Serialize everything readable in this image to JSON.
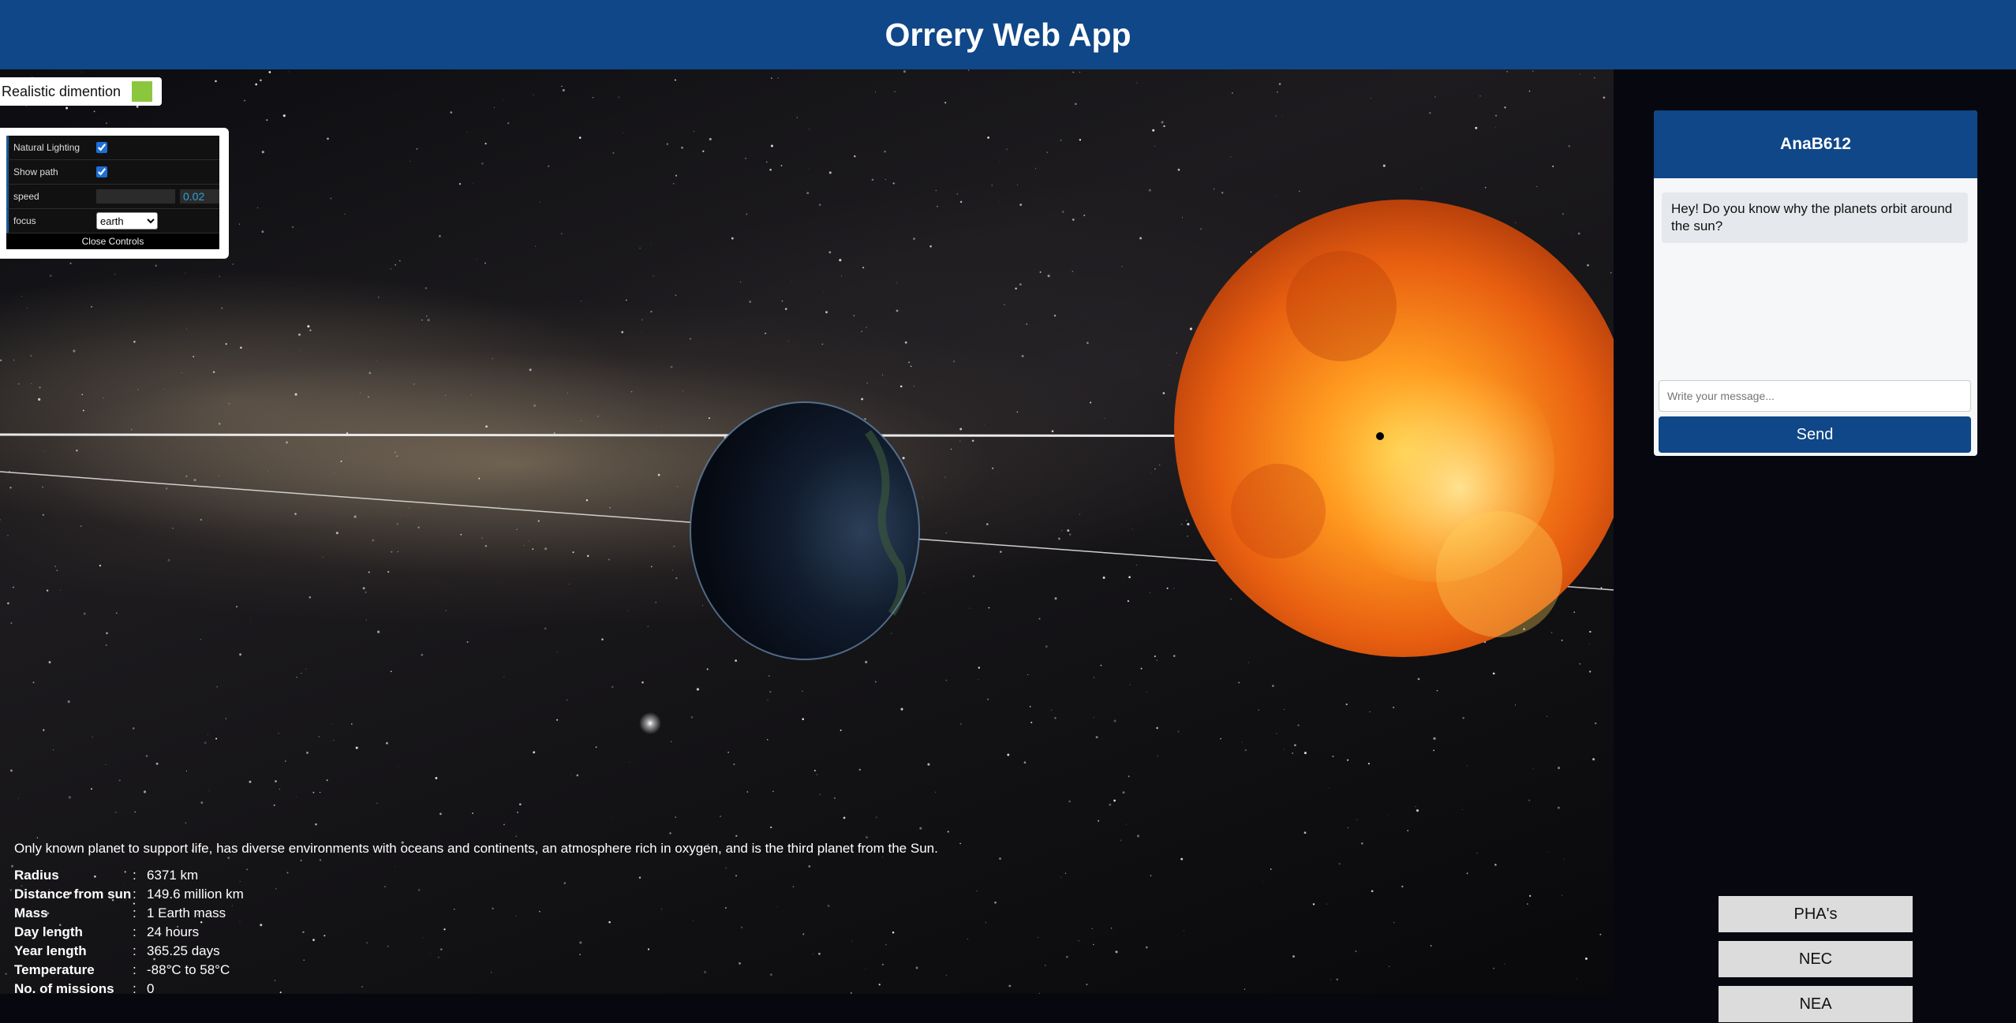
{
  "app": {
    "title": "Orrery Web App"
  },
  "realistic": {
    "label": "Realistic dimention",
    "swatch_color": "#8cc63f"
  },
  "controls": {
    "natural_lighting_label": "Natural Lighting",
    "natural_lighting_checked": true,
    "show_path_label": "Show path",
    "show_path_checked": true,
    "speed_label": "speed",
    "speed_value": "0.02",
    "focus_label": "focus",
    "focus_value": "earth",
    "close_label": "Close Controls"
  },
  "planet": {
    "description": "Only known planet to support life, has diverse environments with oceans and continents, an atmosphere rich in oxygen, and is the third planet from the Sun.",
    "stats": [
      {
        "key": "Radius",
        "value": "6371 km"
      },
      {
        "key": "Distance from sun",
        "value": "149.6 million km"
      },
      {
        "key": "Mass",
        "value": "1 Earth mass"
      },
      {
        "key": "Day length",
        "value": "24 hours"
      },
      {
        "key": "Year length",
        "value": "365.25 days"
      },
      {
        "key": "Temperature",
        "value": "-88°C to 58°C"
      },
      {
        "key": "No. of missions",
        "value": "0"
      }
    ]
  },
  "chat": {
    "title": "AnaB612",
    "message": "Hey! Do you know why the planets orbit around the sun?",
    "input_placeholder": "Write your message...",
    "send_label": "Send"
  },
  "side_buttons": {
    "pha": "PHA's",
    "nec": "NEC",
    "nea": "NEA"
  },
  "colors": {
    "header": "#0f4788",
    "accent": "#0f4788",
    "sun": "#f07a1a",
    "earth": "#0e1a2e"
  }
}
